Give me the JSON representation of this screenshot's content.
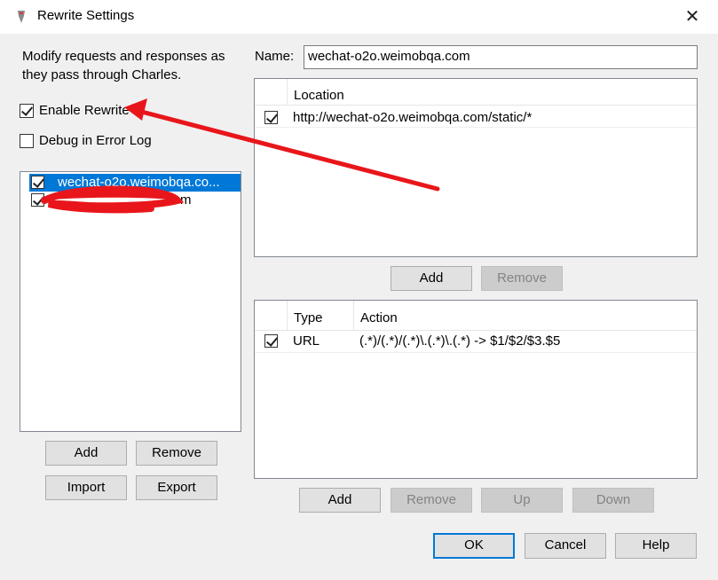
{
  "window": {
    "title": "Rewrite Settings"
  },
  "left": {
    "description": "Modify requests and responses as they pass through Charles.",
    "enable_rewrite_label": "Enable Rewrite",
    "enable_rewrite_checked": true,
    "debug_label": "Debug in Error Log",
    "debug_checked": false,
    "sets": [
      {
        "name": "wechat-o2o.weimobqa.co...",
        "checked": true,
        "selected": true
      },
      {
        "name": "m",
        "checked": true,
        "selected": false
      }
    ],
    "buttons": {
      "add": "Add",
      "remove": "Remove",
      "import": "Import",
      "export": "Export"
    }
  },
  "right": {
    "name_label": "Name:",
    "name_value": "wechat-o2o.weimobqa.com",
    "locations": {
      "header": "Location",
      "rows": [
        {
          "checked": true,
          "location": "http://wechat-o2o.weimobqa.com/static/*"
        }
      ],
      "buttons": {
        "add": "Add",
        "remove": "Remove"
      }
    },
    "rules": {
      "headers": {
        "type": "Type",
        "action": "Action"
      },
      "rows": [
        {
          "checked": true,
          "type": "URL",
          "action": "(.*)/(.*)/(.*)\\.(.*)\\.(.*) -> $1/$2/$3.$5"
        }
      ],
      "buttons": {
        "add": "Add",
        "remove": "Remove",
        "up": "Up",
        "down": "Down"
      }
    }
  },
  "footer": {
    "ok": "OK",
    "cancel": "Cancel",
    "help": "Help"
  },
  "annotation": {
    "color": "#e8161b"
  }
}
